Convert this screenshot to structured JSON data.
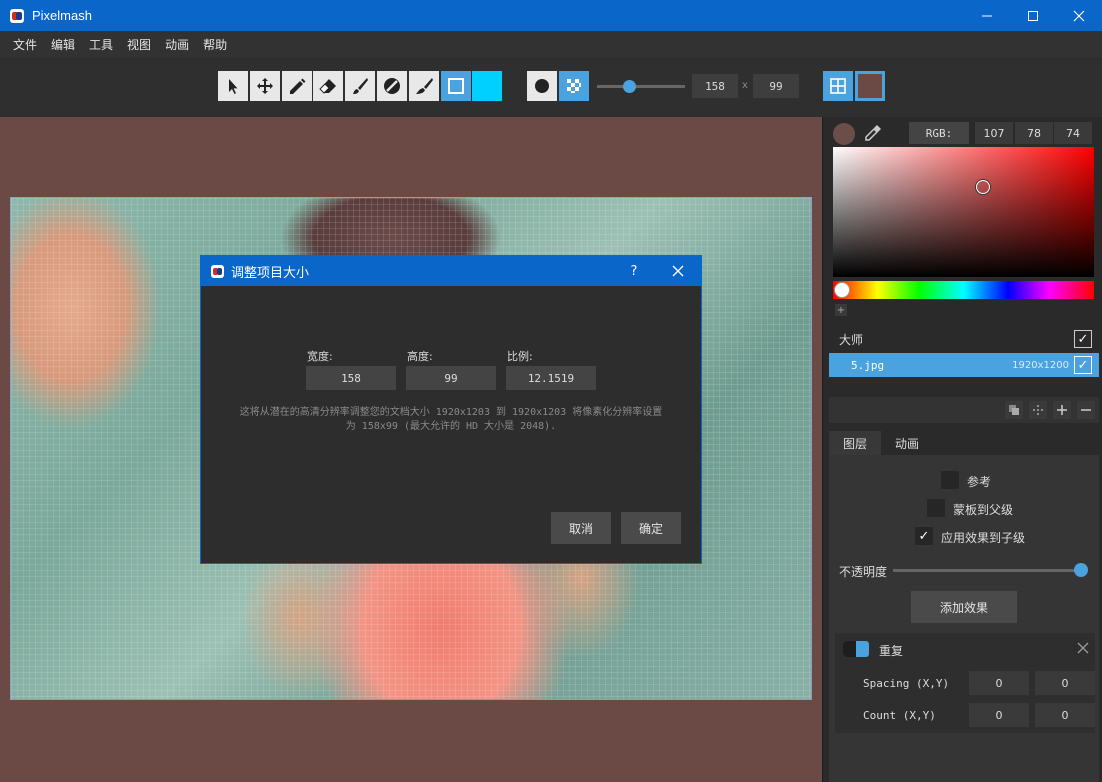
{
  "window": {
    "title": "Pixelmash"
  },
  "menu": [
    "文件",
    "编辑",
    "工具",
    "视图",
    "动画",
    "帮助"
  ],
  "toolbar": {
    "tools": [
      "pointer-icon",
      "move-icon",
      "pencil-icon",
      "eraser-icon",
      "brush-icon",
      "fill-icon",
      "paint-brush-icon",
      "rectangle-icon",
      "color-swatch"
    ],
    "active_tool": "rectangle-icon",
    "width": "158",
    "separator": "x",
    "height": "99"
  },
  "colors": {
    "accent": "#4aa3df",
    "titlebar": "#0a66c8",
    "canvas_bg": "#6b4a46",
    "current_color": "#6b4e4a",
    "cyan": "#00d0ff"
  },
  "color_panel": {
    "mode_label": "RGB:",
    "r": "107",
    "g": "78",
    "b": "74"
  },
  "layers": {
    "group_name": "大师",
    "items": [
      {
        "name": "5.jpg",
        "size": "1920x1200"
      }
    ]
  },
  "tabs": [
    "图层",
    "动画"
  ],
  "layer_props": {
    "reference": "参考",
    "mask_to_parent": "蒙板到父级",
    "apply_effects_to_children": "应用效果到子级",
    "opacity_label": "不透明度",
    "add_effect": "添加效果"
  },
  "effect": {
    "name": "重复",
    "spacing_label": "Spacing (X,Y)",
    "spacing_x": "0",
    "spacing_y": "0",
    "count_label": "Count (X,Y)",
    "count_x": "0",
    "count_y": "0"
  },
  "dialog": {
    "title": "调整项目大小",
    "help": "?",
    "width_label": "宽度:",
    "width_value": "158",
    "height_label": "高度:",
    "height_value": "99",
    "ratio_label": "比例:",
    "ratio_value": "12.1519",
    "desc_line1": "这将从潜在的高清分辨率调整您的文档大小 1920x1203 到 1920x1203 将像素化分辨率设置",
    "desc_line2": "为 158x99 (最大允许的 HD 大小是 2048).",
    "cancel": "取消",
    "ok": "确定"
  }
}
